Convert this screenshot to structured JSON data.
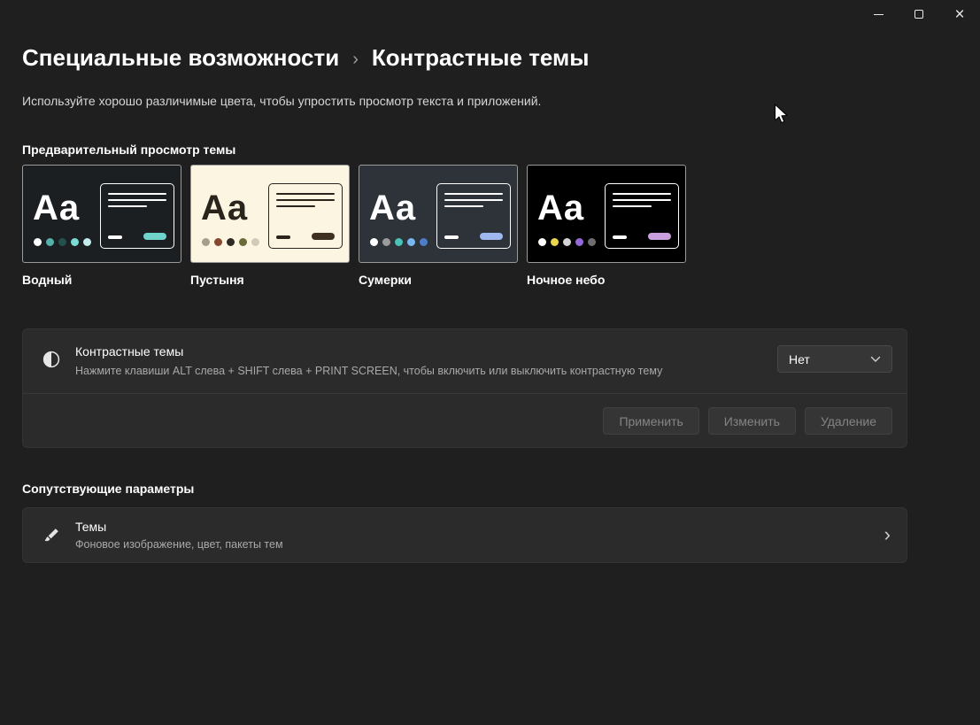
{
  "window": {
    "controls": {
      "close_glyph": "×"
    }
  },
  "header": {
    "breadcrumb": {
      "parent": "Специальные возможности",
      "separator": "›",
      "current": "Контрастные темы"
    },
    "description": "Используйте хорошо различимые цвета, чтобы упростить просмотр текста и приложений."
  },
  "preview_section": {
    "label": "Предварительный просмотр темы",
    "sample_text": "Aa",
    "themes": [
      {
        "name": "Водный",
        "colors": {
          "background": "#1b1f22",
          "text": "#ffffff",
          "accent": "#6fd3cc",
          "dots": [
            "#ffffff",
            "#54b2ab",
            "#23514e",
            "#7adcd5",
            "#c2edeb"
          ]
        }
      },
      {
        "name": "Пустыня",
        "colors": {
          "background": "#fbf5e1",
          "text": "#2a251c",
          "accent": "#3f3021",
          "dots": [
            "#a89e8e",
            "#84492e",
            "#2e2a24",
            "#6a6a38",
            "#d2c9b6"
          ]
        }
      },
      {
        "name": "Сумерки",
        "colors": {
          "background": "#2d3338",
          "text": "#ffffff",
          "accent": "#9fb8f0",
          "dots": [
            "#ffffff",
            "#9b9b9b",
            "#4ac3b9",
            "#79b7f0",
            "#4d7ec7"
          ]
        }
      },
      {
        "name": "Ночное небо",
        "colors": {
          "background": "#000000",
          "text": "#ffffff",
          "accent": "#c9a0dd",
          "dots": [
            "#ffffff",
            "#e8d44d",
            "#d4d4d4",
            "#9468d6",
            "#6e6e6e"
          ]
        }
      }
    ]
  },
  "contrast_card": {
    "title": "Контрастные темы",
    "description": "Нажмите клавиши ALT слева + SHIFT слева + PRINT SCREEN, чтобы включить или выключить контрастную тему",
    "dropdown": {
      "value": "Нет"
    },
    "buttons": [
      {
        "label": "Применить",
        "enabled": false
      },
      {
        "label": "Изменить",
        "enabled": false
      },
      {
        "label": "Удаление",
        "enabled": false
      }
    ]
  },
  "related_section": {
    "label": "Сопутствующие параметры",
    "chevron": "›",
    "items": [
      {
        "title": "Темы",
        "subtitle": "Фоновое изображение, цвет, пакеты тем"
      }
    ]
  }
}
